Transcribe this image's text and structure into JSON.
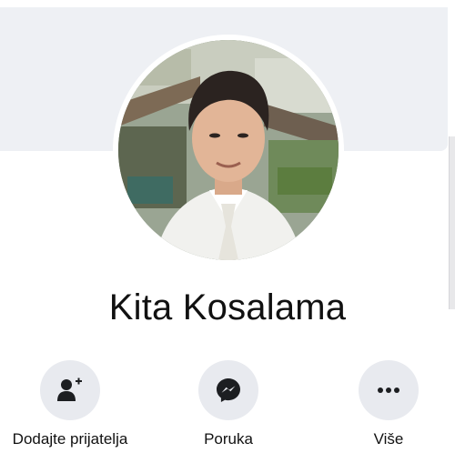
{
  "profile": {
    "name": "Kita Kosalama"
  },
  "actions": [
    {
      "label": "Dodajte prijatelja",
      "icon": "add-friend-icon"
    },
    {
      "label": "Poruka",
      "icon": "messenger-icon"
    },
    {
      "label": "Više",
      "icon": "more-icon"
    }
  ],
  "colors": {
    "cover": "#eef0f4",
    "action_bg": "#e8eaef",
    "icon": "#1c1e21",
    "text": "#111111"
  }
}
